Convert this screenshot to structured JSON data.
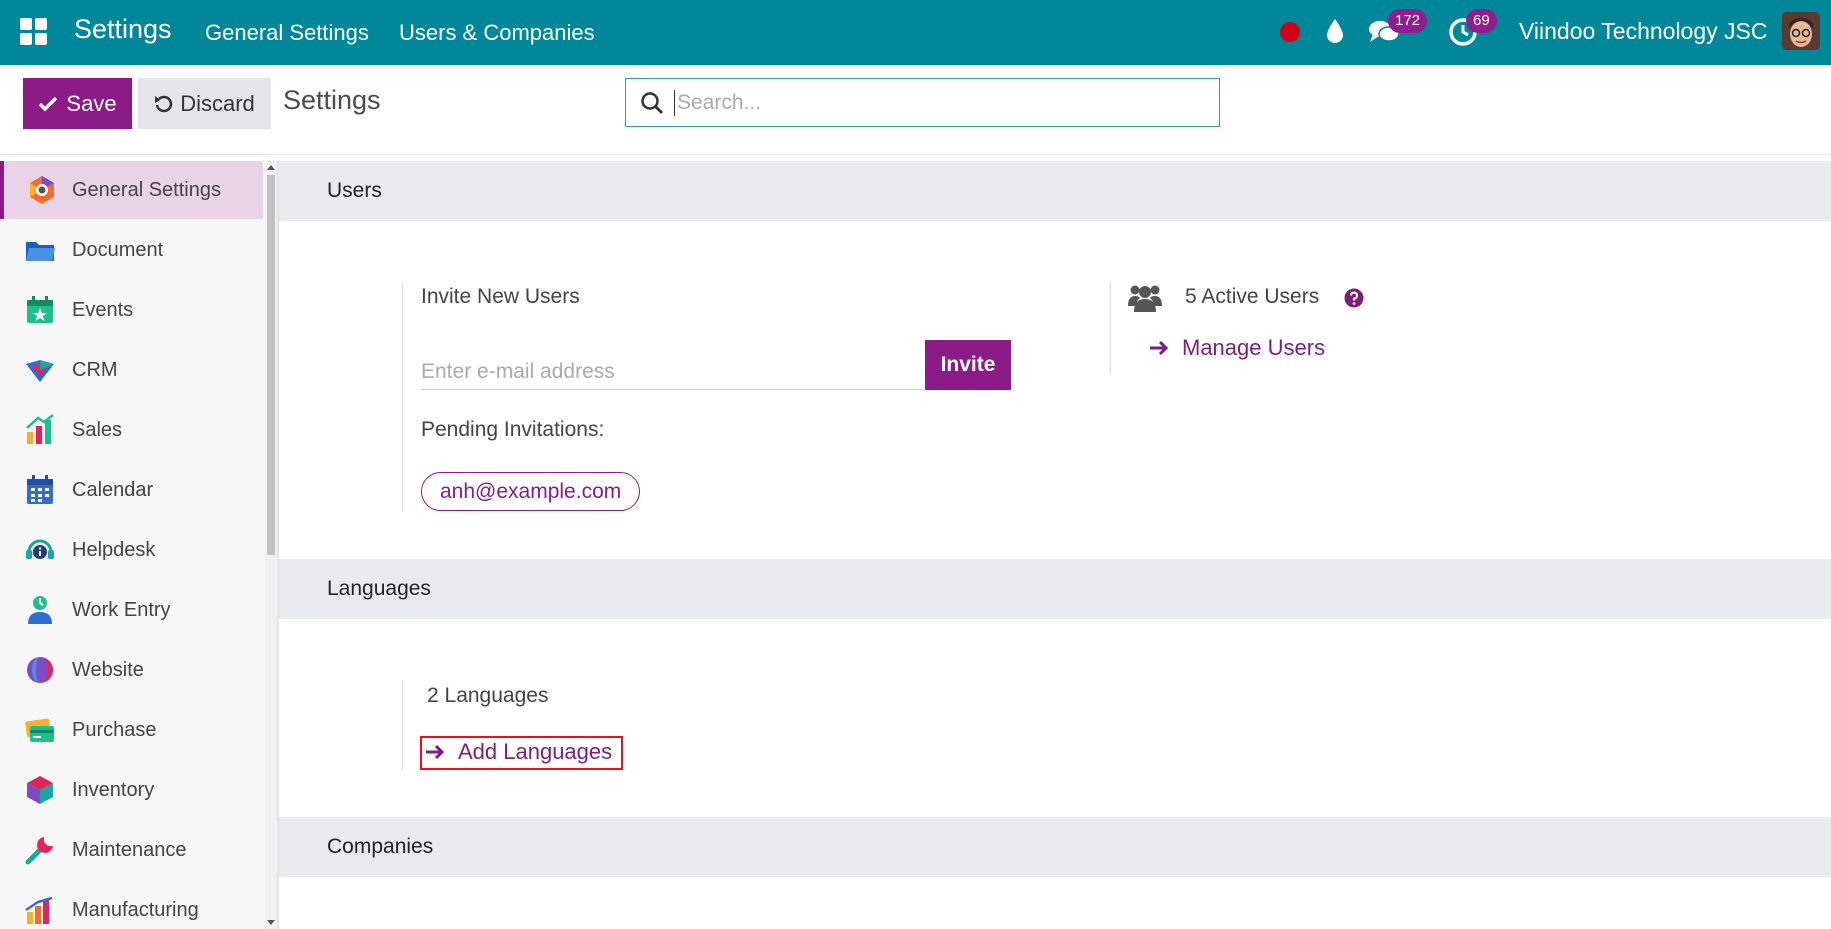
{
  "navbar": {
    "brand": "Settings",
    "menu": [
      "General Settings",
      "Users & Companies"
    ],
    "chat_count": "172",
    "activity_count": "69",
    "company": "Viindoo Technology JSC"
  },
  "control": {
    "save_label": "Save",
    "discard_label": "Discard",
    "breadcrumb": "Settings",
    "search_placeholder": "Search..."
  },
  "sidebar": {
    "items": [
      {
        "label": "General Settings",
        "icon": "general-settings-icon"
      },
      {
        "label": "Document",
        "icon": "folder-icon"
      },
      {
        "label": "Events",
        "icon": "event-icon"
      },
      {
        "label": "CRM",
        "icon": "crm-icon"
      },
      {
        "label": "Sales",
        "icon": "sales-icon"
      },
      {
        "label": "Calendar",
        "icon": "calendar-icon"
      },
      {
        "label": "Helpdesk",
        "icon": "helpdesk-icon"
      },
      {
        "label": "Work Entry",
        "icon": "work-entry-icon"
      },
      {
        "label": "Website",
        "icon": "website-icon"
      },
      {
        "label": "Purchase",
        "icon": "purchase-icon"
      },
      {
        "label": "Inventory",
        "icon": "inventory-icon"
      },
      {
        "label": "Maintenance",
        "icon": "maintenance-icon"
      },
      {
        "label": "Manufacturing",
        "icon": "manufacturing-icon"
      }
    ]
  },
  "users": {
    "section_title": "Users",
    "invite_title": "Invite New Users",
    "email_placeholder": "Enter e-mail address",
    "invite_label": "Invite",
    "pending_label": "Pending Invitations:",
    "pending_email": "anh@example.com",
    "active_users": "5 Active Users",
    "manage_users": "Manage Users"
  },
  "languages": {
    "section_title": "Languages",
    "count_text": "2 Languages",
    "add_label": "Add Languages"
  },
  "companies": {
    "section_title": "Companies"
  },
  "colors": {
    "navbar": "#00889a",
    "primary": "#8a1b87",
    "highlight": "#e0141c"
  }
}
